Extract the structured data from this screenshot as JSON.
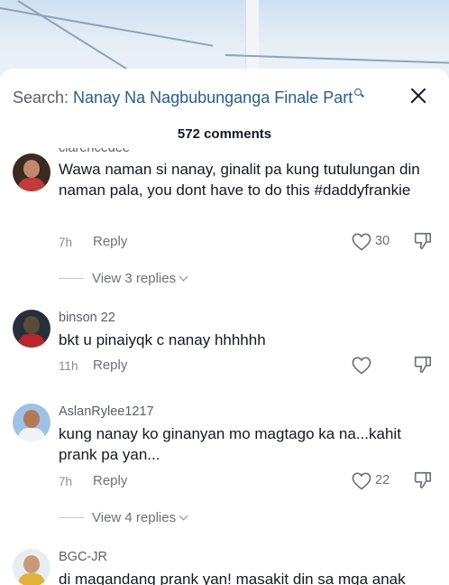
{
  "header": {
    "search_prefix": "Search: ",
    "search_query": "Nanay Na Nagbubunganga Finale Part",
    "comment_count": "572 comments"
  },
  "comments": [
    {
      "username": "clarencedee",
      "text": "Wawa naman si nanay, ginalit pa kung tutulungan din naman pala, you dont have to do this #daddyfrankie",
      "time": "7h",
      "reply_label": "Reply",
      "likes": "30",
      "view_replies": "View 3 replies"
    },
    {
      "username": "binson 22",
      "text": "bkt u pinaiyqk c nanay hhhhhh",
      "time": "11h",
      "reply_label": "Reply",
      "likes": ""
    },
    {
      "username": "AslanRylee1217",
      "text": "kung nanay ko ginanyan mo magtago ka na...kahit prank pa yan...",
      "time": "7h",
      "reply_label": "Reply",
      "likes": "22",
      "view_replies": "View 4 replies"
    },
    {
      "username": "BGC-JR",
      "text": "di magandang prank yan! masakit din sa mga anak"
    }
  ],
  "icons": {
    "close": "close-icon",
    "search": "search-icon",
    "like": "heart-icon",
    "dislike": "thumbs-down-icon",
    "expand": "chevron-down-icon"
  },
  "colors": {
    "search_query": "#2c5c8c",
    "secondary_text": "#6e7078",
    "primary_text": "#161823"
  }
}
